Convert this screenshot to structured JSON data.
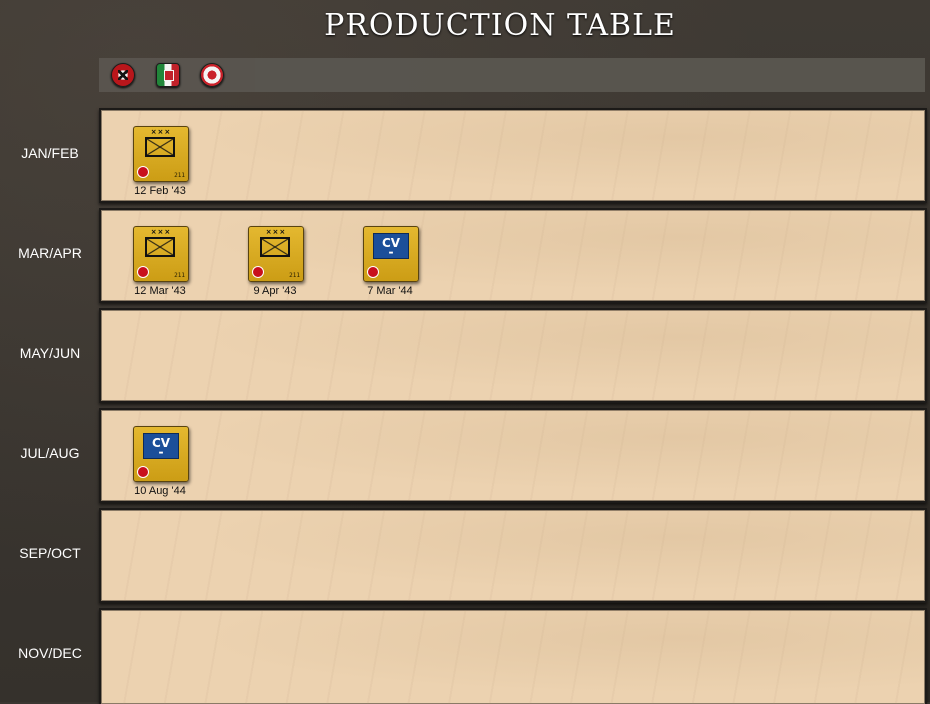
{
  "title": "PRODUCTION TABLE",
  "flags": [
    {
      "name": "germany-flag-icon"
    },
    {
      "name": "italy-flag-icon"
    },
    {
      "name": "japan-flag-icon"
    }
  ],
  "rows": [
    {
      "label": "JAN/FEB",
      "units": [
        {
          "type": "infantry-army",
          "code": "211",
          "date": "12 Feb '43"
        }
      ]
    },
    {
      "label": "MAR/APR",
      "units": [
        {
          "type": "infantry-army",
          "code": "211",
          "date": "12 Mar '43"
        },
        {
          "type": "infantry-army",
          "code": "211",
          "date": "9 Apr '43"
        },
        {
          "type": "carrier",
          "cv_label": "CV",
          "date": "7 Mar '44"
        }
      ]
    },
    {
      "label": "MAY/JUN",
      "units": []
    },
    {
      "label": "JUL/AUG",
      "units": [
        {
          "type": "carrier",
          "cv_label": "CV",
          "date": "10 Aug '44"
        }
      ]
    },
    {
      "label": "SEP/OCT",
      "units": []
    },
    {
      "label": "NOV/DEC",
      "units": []
    }
  ],
  "army_symbol": "×××",
  "colors": {
    "panel": "#ecd2b0",
    "unit": "#d9aa20",
    "carrier": "#1b4f9a",
    "nation_dot": "#c8101c"
  }
}
